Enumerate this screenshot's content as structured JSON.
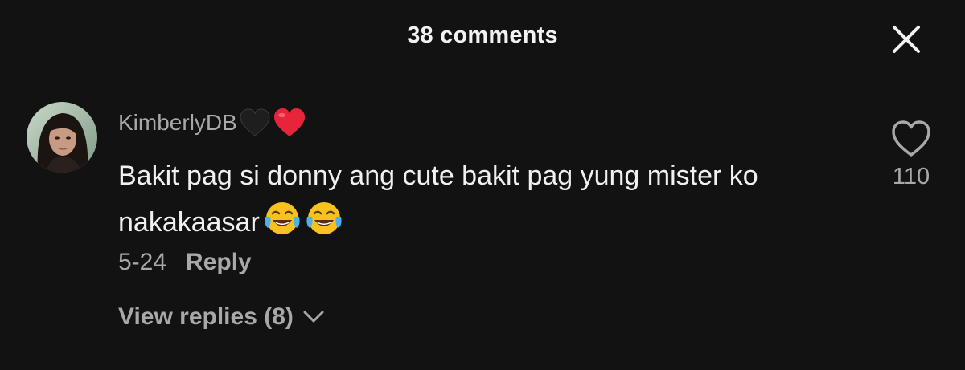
{
  "header": {
    "title": "38 comments",
    "close_icon": "close-icon"
  },
  "comment": {
    "username": "KimberlyDB",
    "username_emojis": [
      "black-heart-icon",
      "red-heart-icon"
    ],
    "text": "Bakit pag si donny ang cute bakit pag yung mister ko nakakaasar",
    "text_emojis": [
      "tears-of-joy-icon",
      "tears-of-joy-icon"
    ],
    "date": "5-24",
    "reply_label": "Reply",
    "like_icon": "heart-outline-icon",
    "like_count": "110",
    "view_replies_label": "View replies (8)",
    "view_replies_icon": "chevron-down-icon"
  },
  "colors": {
    "background": "#121212",
    "primary_text": "#f0f0f0",
    "secondary_text": "#a8a8a8",
    "heart_red": "#e8243a"
  }
}
